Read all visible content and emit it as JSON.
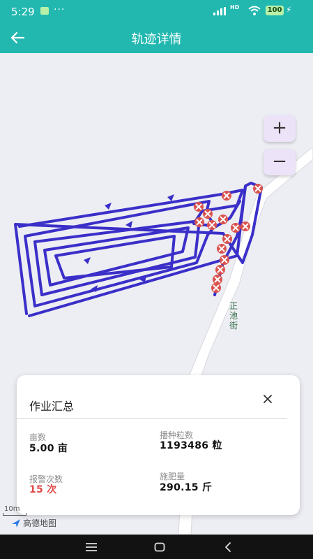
{
  "status_bar": {
    "time": "5:29",
    "dots": "···",
    "network": "HD",
    "battery": "100",
    "icons": [
      "app-notification-icon",
      "signal-icon",
      "wifi-icon",
      "battery-icon",
      "charging-icon"
    ]
  },
  "header": {
    "title": "轨迹详情",
    "back_icon": "arrow-left-icon",
    "background": "#22b8b0"
  },
  "map": {
    "zoom_in_label": "+",
    "zoom_out_label": "−",
    "street_name": "正池街",
    "scale_label": "10m",
    "brand": "高德地图",
    "track_color": "#3b2fc9",
    "alarm_color": "#d9534f"
  },
  "summary_panel": {
    "title": "作业汇总",
    "close_icon": "close-icon",
    "stats": {
      "area": {
        "label": "亩数",
        "value": "5.00 亩"
      },
      "seeds": {
        "label": "播种粒数",
        "value": "1193486 粒"
      },
      "alarms": {
        "label": "报警次数",
        "value": "15 次"
      },
      "fertilizer": {
        "label": "施肥量",
        "value": "290.15 斤"
      }
    }
  },
  "nav_bar": {
    "icons": [
      "menu-icon",
      "home-icon",
      "back-icon"
    ]
  }
}
